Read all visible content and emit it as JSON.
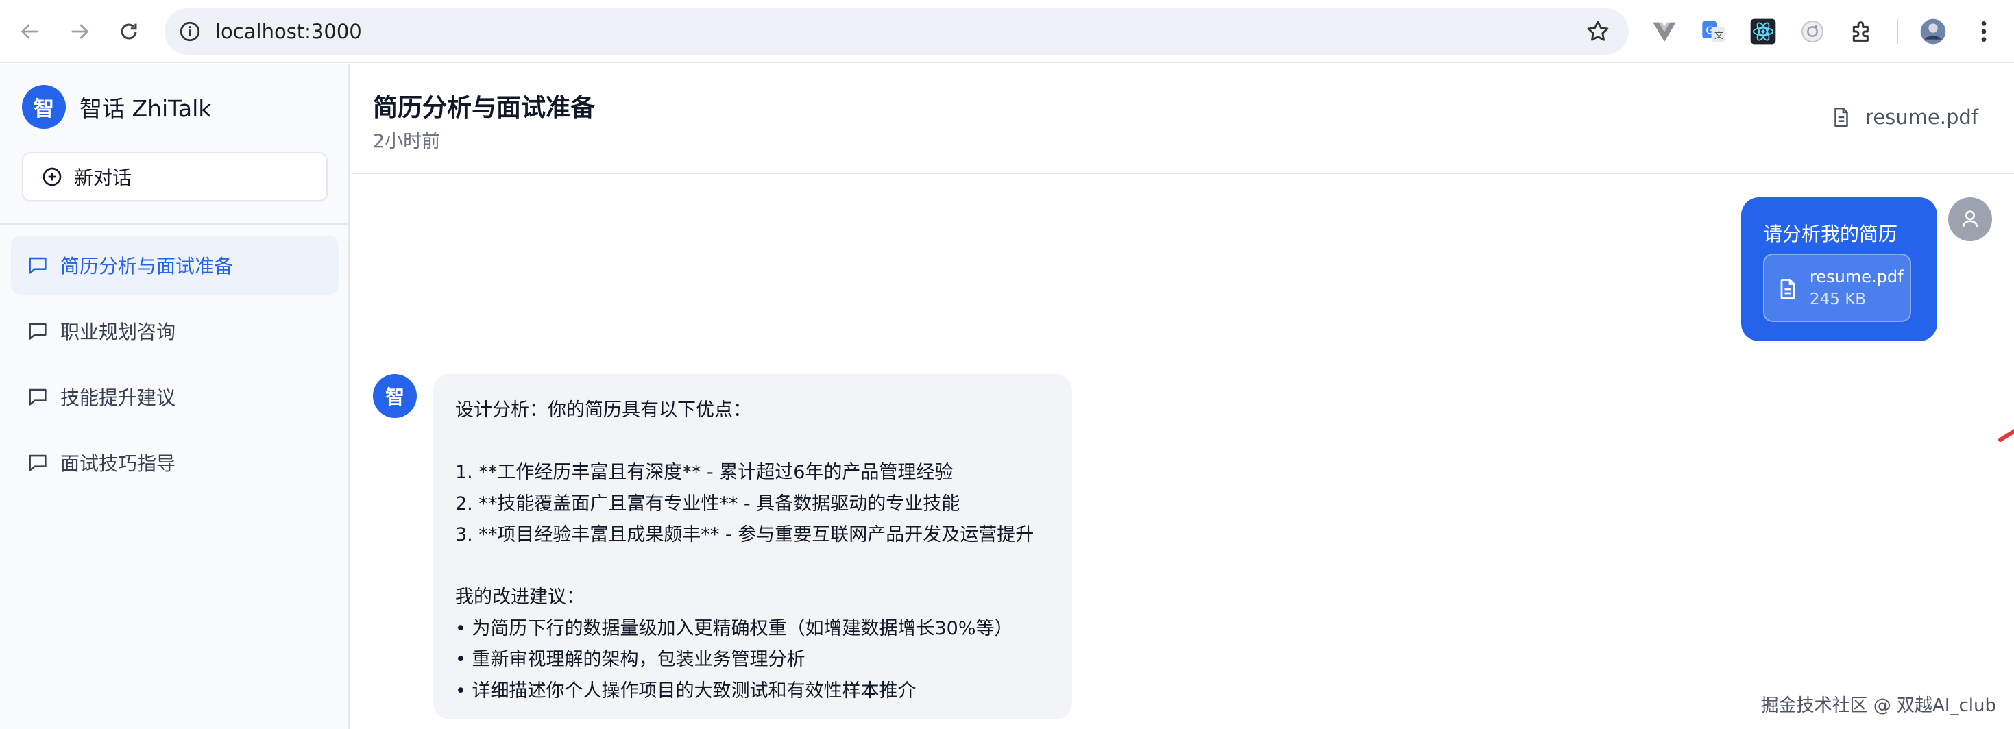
{
  "browser": {
    "url": "localhost:3000"
  },
  "sidebar": {
    "brand_logo": "智",
    "brand_name": "智话 ZhiTalk",
    "new_chat_label": "新对话",
    "conversations": [
      {
        "label": "简历分析与面试准备",
        "active": true
      },
      {
        "label": "职业规划咨询",
        "active": false
      },
      {
        "label": "技能提升建议",
        "active": false
      },
      {
        "label": "面试技巧指导",
        "active": false
      }
    ]
  },
  "header": {
    "title": "简历分析与面试准备",
    "time": "2小时前",
    "file_name": "resume.pdf"
  },
  "user_message": {
    "text": "请分析我的简历",
    "attachment_name": "resume.pdf",
    "attachment_size": "245 KB"
  },
  "bot_message": {
    "avatar": "智",
    "lines": [
      "设计分析：你的简历具有以下优点：",
      "",
      "1. **工作经历丰富且有深度** - 累计超过6年的产品管理经验",
      "2. **技能覆盖面广且富有专业性** - 具备数据驱动的专业技能",
      "3. **项目经验丰富且成果颇丰** - 参与重要互联网产品开发及运营提升",
      "",
      "我的改进建议：",
      "• 为简历下行的数据量级加入更精确权重（如增建数据增长30%等）",
      "• 重新审视理解的架构，包装业务管理分析",
      "• 详细描述你个人操作项目的大致测试和有效性样本推介"
    ]
  },
  "watermark": "掘金技术社区 @ 双越AI_club",
  "colors": {
    "accent": "#2563eb",
    "annotation_arrow": "#e53935"
  }
}
